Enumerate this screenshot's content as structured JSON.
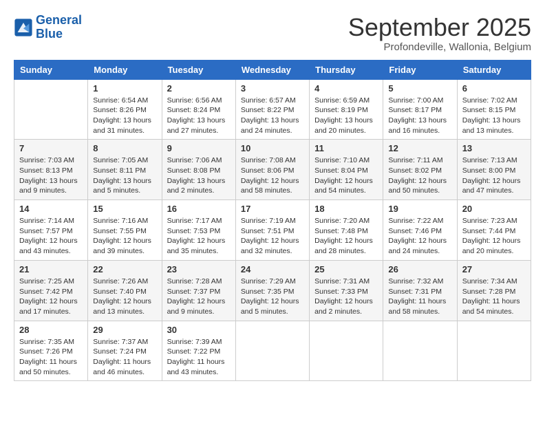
{
  "logo": {
    "line1": "General",
    "line2": "Blue"
  },
  "title": "September 2025",
  "subtitle": "Profondeville, Wallonia, Belgium",
  "days_of_week": [
    "Sunday",
    "Monday",
    "Tuesday",
    "Wednesday",
    "Thursday",
    "Friday",
    "Saturday"
  ],
  "weeks": [
    [
      {
        "day": "",
        "info": ""
      },
      {
        "day": "1",
        "info": "Sunrise: 6:54 AM\nSunset: 8:26 PM\nDaylight: 13 hours\nand 31 minutes."
      },
      {
        "day": "2",
        "info": "Sunrise: 6:56 AM\nSunset: 8:24 PM\nDaylight: 13 hours\nand 27 minutes."
      },
      {
        "day": "3",
        "info": "Sunrise: 6:57 AM\nSunset: 8:22 PM\nDaylight: 13 hours\nand 24 minutes."
      },
      {
        "day": "4",
        "info": "Sunrise: 6:59 AM\nSunset: 8:19 PM\nDaylight: 13 hours\nand 20 minutes."
      },
      {
        "day": "5",
        "info": "Sunrise: 7:00 AM\nSunset: 8:17 PM\nDaylight: 13 hours\nand 16 minutes."
      },
      {
        "day": "6",
        "info": "Sunrise: 7:02 AM\nSunset: 8:15 PM\nDaylight: 13 hours\nand 13 minutes."
      }
    ],
    [
      {
        "day": "7",
        "info": "Sunrise: 7:03 AM\nSunset: 8:13 PM\nDaylight: 13 hours\nand 9 minutes."
      },
      {
        "day": "8",
        "info": "Sunrise: 7:05 AM\nSunset: 8:11 PM\nDaylight: 13 hours\nand 5 minutes."
      },
      {
        "day": "9",
        "info": "Sunrise: 7:06 AM\nSunset: 8:08 PM\nDaylight: 13 hours\nand 2 minutes."
      },
      {
        "day": "10",
        "info": "Sunrise: 7:08 AM\nSunset: 8:06 PM\nDaylight: 12 hours\nand 58 minutes."
      },
      {
        "day": "11",
        "info": "Sunrise: 7:10 AM\nSunset: 8:04 PM\nDaylight: 12 hours\nand 54 minutes."
      },
      {
        "day": "12",
        "info": "Sunrise: 7:11 AM\nSunset: 8:02 PM\nDaylight: 12 hours\nand 50 minutes."
      },
      {
        "day": "13",
        "info": "Sunrise: 7:13 AM\nSunset: 8:00 PM\nDaylight: 12 hours\nand 47 minutes."
      }
    ],
    [
      {
        "day": "14",
        "info": "Sunrise: 7:14 AM\nSunset: 7:57 PM\nDaylight: 12 hours\nand 43 minutes."
      },
      {
        "day": "15",
        "info": "Sunrise: 7:16 AM\nSunset: 7:55 PM\nDaylight: 12 hours\nand 39 minutes."
      },
      {
        "day": "16",
        "info": "Sunrise: 7:17 AM\nSunset: 7:53 PM\nDaylight: 12 hours\nand 35 minutes."
      },
      {
        "day": "17",
        "info": "Sunrise: 7:19 AM\nSunset: 7:51 PM\nDaylight: 12 hours\nand 32 minutes."
      },
      {
        "day": "18",
        "info": "Sunrise: 7:20 AM\nSunset: 7:48 PM\nDaylight: 12 hours\nand 28 minutes."
      },
      {
        "day": "19",
        "info": "Sunrise: 7:22 AM\nSunset: 7:46 PM\nDaylight: 12 hours\nand 24 minutes."
      },
      {
        "day": "20",
        "info": "Sunrise: 7:23 AM\nSunset: 7:44 PM\nDaylight: 12 hours\nand 20 minutes."
      }
    ],
    [
      {
        "day": "21",
        "info": "Sunrise: 7:25 AM\nSunset: 7:42 PM\nDaylight: 12 hours\nand 17 minutes."
      },
      {
        "day": "22",
        "info": "Sunrise: 7:26 AM\nSunset: 7:40 PM\nDaylight: 12 hours\nand 13 minutes."
      },
      {
        "day": "23",
        "info": "Sunrise: 7:28 AM\nSunset: 7:37 PM\nDaylight: 12 hours\nand 9 minutes."
      },
      {
        "day": "24",
        "info": "Sunrise: 7:29 AM\nSunset: 7:35 PM\nDaylight: 12 hours\nand 5 minutes."
      },
      {
        "day": "25",
        "info": "Sunrise: 7:31 AM\nSunset: 7:33 PM\nDaylight: 12 hours\nand 2 minutes."
      },
      {
        "day": "26",
        "info": "Sunrise: 7:32 AM\nSunset: 7:31 PM\nDaylight: 11 hours\nand 58 minutes."
      },
      {
        "day": "27",
        "info": "Sunrise: 7:34 AM\nSunset: 7:28 PM\nDaylight: 11 hours\nand 54 minutes."
      }
    ],
    [
      {
        "day": "28",
        "info": "Sunrise: 7:35 AM\nSunset: 7:26 PM\nDaylight: 11 hours\nand 50 minutes."
      },
      {
        "day": "29",
        "info": "Sunrise: 7:37 AM\nSunset: 7:24 PM\nDaylight: 11 hours\nand 46 minutes."
      },
      {
        "day": "30",
        "info": "Sunrise: 7:39 AM\nSunset: 7:22 PM\nDaylight: 11 hours\nand 43 minutes."
      },
      {
        "day": "",
        "info": ""
      },
      {
        "day": "",
        "info": ""
      },
      {
        "day": "",
        "info": ""
      },
      {
        "day": "",
        "info": ""
      }
    ]
  ]
}
